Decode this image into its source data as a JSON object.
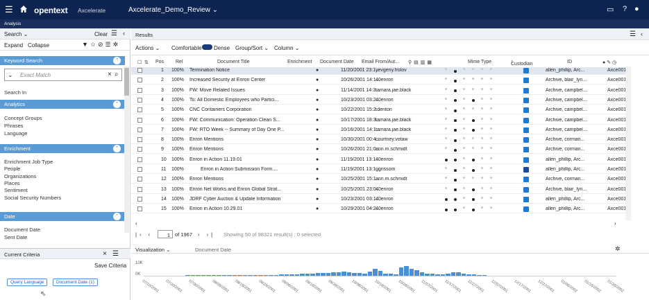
{
  "topbar": {
    "brand": "opentext",
    "product": "Axcelerate",
    "case": "Axcelerate_Demo_Review",
    "subtitle": "Analysis"
  },
  "left": {
    "search_label": "Search",
    "clear": "Clear",
    "expand": "Expand",
    "collapse": "Collapse",
    "keyword_search": "Keyword Search",
    "exact_match": "Exact Match",
    "search_in": "Search In",
    "analytics": "Analytics",
    "analytics_items": [
      "Concept Groups",
      "Phrases",
      "Language"
    ],
    "enrichment": "Enrichment",
    "enrichment_items": [
      "Enrichment Job Type",
      "People",
      "Organizations",
      "Places",
      "Sentiment",
      "Social Security Numbers"
    ],
    "date": "Date",
    "date_items": [
      "Document Date",
      "Sent Date"
    ],
    "current_criteria": "Current Criteria",
    "save_criteria": "Save Criteria",
    "pill1": "Query Language",
    "pill2": "Document Date (1)"
  },
  "results": {
    "title": "Results",
    "actions": "Actions",
    "comfortable": "Comfortable",
    "dense": "Dense",
    "groupsort": "Group/Sort",
    "column": "Column",
    "headers": {
      "pos": "Pos",
      "rel": "Rel",
      "title": "Document Title",
      "enrichment": "Enrichment",
      "docdate": "Document Date",
      "email": "Email From/Aut...",
      "mime": "Mime Type",
      "custodian": "Custodian",
      "id": "ID"
    },
    "rows": [
      {
        "pos": "1",
        "rel": "100%",
        "title": "Termination Notice",
        "date": "11/20/2001 23:1...",
        "email": "yevgeny.frolov",
        "cust": "allen_phillip, Arc...",
        "id": "Axce001"
      },
      {
        "pos": "2",
        "rel": "100%",
        "title": "Increased Security at Enron Center",
        "date": "10/26/2001 14:1...",
        "email": "40enron",
        "cust": "Archive, blair_lyn...",
        "id": "Axce001"
      },
      {
        "pos": "3",
        "rel": "100%",
        "title": "FW: Move Related Issues",
        "date": "11/14/2001 14:3...",
        "email": "tamara.jae.black",
        "cust": "Archive, campbel...",
        "id": "Axce001"
      },
      {
        "pos": "4",
        "rel": "100%",
        "title": "To: All Domestic Employees who Partici...",
        "date": "10/23/2001 03:2...",
        "email": "40enron",
        "cust": "Archive, campbel...",
        "id": "Axce001"
      },
      {
        "pos": "5",
        "rel": "100%",
        "title": "CNC Containers Corporation",
        "date": "10/22/2001 15:2...",
        "email": "rdenton",
        "cust": "Archive, campbel...",
        "id": "Axce001"
      },
      {
        "pos": "6",
        "rel": "100%",
        "title": "FW: Communication: Operation Clean S...",
        "date": "10/17/2001 18:3...",
        "email": "tamara.jae.black",
        "cust": "Archive, campbel...",
        "id": "Axce001"
      },
      {
        "pos": "7",
        "rel": "100%",
        "title": "FW: RTO Week -- Summary of Day One P...",
        "date": "10/16/2001 14:1...",
        "email": "tamara.jae.black",
        "cust": "Archive, campbel...",
        "id": "Axce001"
      },
      {
        "pos": "8",
        "rel": "100%",
        "title": "Enron Mentions",
        "date": "10/30/2001 00:4...",
        "email": "courtney.votaw",
        "cust": "Archive, corman...",
        "id": "Axce001"
      },
      {
        "pos": "9",
        "rel": "100%",
        "title": "Enron Mentions",
        "date": "10/26/2001 21:0...",
        "email": "ann.m.schmidt",
        "cust": "Archive, corman...",
        "id": "Axce001"
      },
      {
        "pos": "10",
        "rel": "100%",
        "title": "Enron in Action 11.19.01",
        "date": "11/19/2001 13:1...",
        "email": "40enron",
        "cust": "allen_phillip, Arc...",
        "id": "Axce001"
      },
      {
        "pos": "11",
        "rel": "100%",
        "title": "Enron in Action Submission Form....",
        "date": "11/19/2001 13:1...",
        "email": "ggrissom",
        "cust": "allen_phillip, Arc...",
        "id": "Axce001"
      },
      {
        "pos": "12",
        "rel": "100%",
        "title": "Enron Mentions",
        "date": "10/25/2001 15:1...",
        "email": "ann.m.schmidt",
        "cust": "Archive, corman...",
        "id": "Axce001"
      },
      {
        "pos": "13",
        "rel": "100%",
        "title": "Enron Net Works and Enron Global Strat...",
        "date": "10/25/2001 23:0...",
        "email": "40enron",
        "cust": "Archive, blair_lyn...",
        "id": "Axce001"
      },
      {
        "pos": "14",
        "rel": "100%",
        "title": "JDRF Cyber Auction & Update Information",
        "date": "10/23/2001 03:1...",
        "email": "40enron",
        "cust": "allen_phillip, Arc...",
        "id": "Axce001"
      },
      {
        "pos": "15",
        "rel": "100%",
        "title": "Enron in Action 10.29.01",
        "date": "10/29/2001 04:2...",
        "email": "40enron",
        "cust": "allen_phillip, Arc...",
        "id": "Axce001"
      }
    ],
    "page": "1",
    "of_pages": "of 1967",
    "showing": "Showing 50 of 98321 result(s) : 0 selected"
  },
  "viz": {
    "label": "Visualization",
    "field": "Document Date",
    "ymax": "10K",
    "ymin": "0K",
    "ticks": [
      "07/10/2001",
      "07/20/2001",
      "07/30/2001",
      "08/09/2001",
      "08/19/2001",
      "08/29/2001",
      "09/08/2001",
      "09/18/2001",
      "09/28/2001",
      "10/08/2001",
      "10/18/2001",
      "10/28/2001",
      "11/07/2001",
      "11/17/2001",
      "11/27/2001",
      "12/07/2001",
      "12/17/2001",
      "12/27/2001",
      "01/06/2002",
      "01/16/2002",
      "01/26/2002"
    ]
  }
}
